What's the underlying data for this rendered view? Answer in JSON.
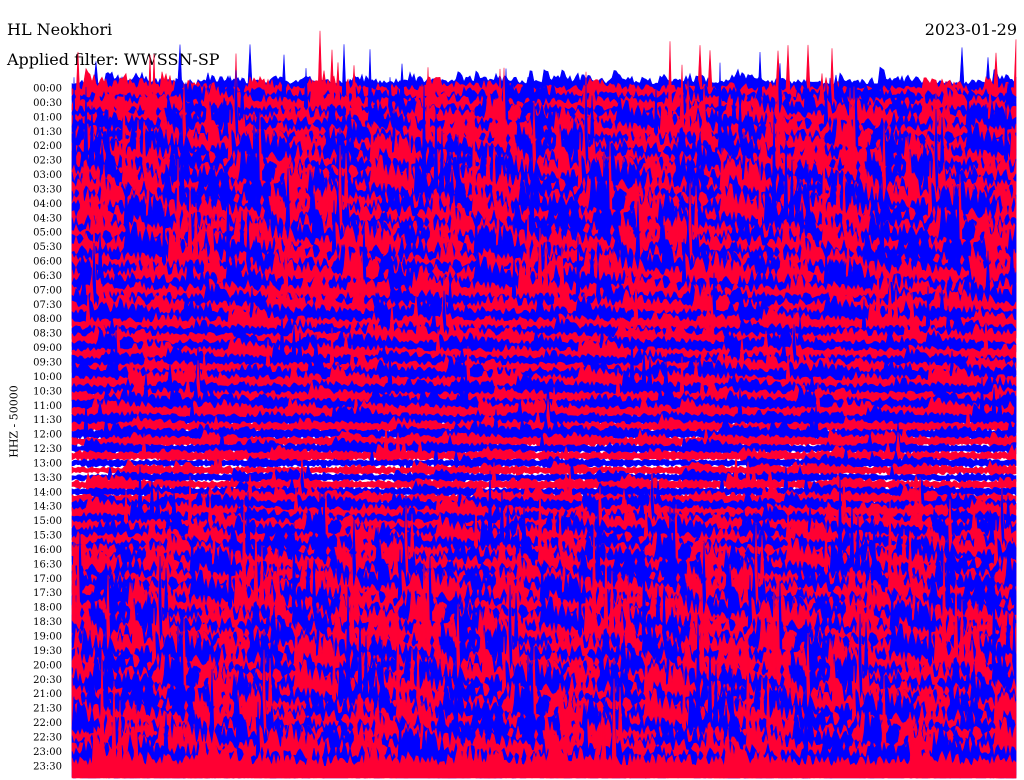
{
  "header": {
    "station": "HL Neokhori",
    "date": "2023-01-29",
    "filter": "Applied filter: WWSSN-SP"
  },
  "channel_label": "HHZ - 50000",
  "chart_data": {
    "type": "line",
    "title": "HL Neokhori",
    "date": "2023-01-29",
    "ylabel": "HHZ - 50000",
    "row_interval_minutes": 15,
    "row_labels": [
      "00:00",
      "00:30",
      "01:00",
      "01:30",
      "02:00",
      "02:30",
      "03:00",
      "03:30",
      "04:00",
      "04:30",
      "05:00",
      "05:30",
      "06:00",
      "06:30",
      "07:00",
      "07:30",
      "08:00",
      "08:30",
      "09:00",
      "09:30",
      "10:00",
      "10:30",
      "11:00",
      "11:30",
      "12:00",
      "12:30",
      "13:00",
      "13:30",
      "14:00",
      "14:30",
      "15:00",
      "15:30",
      "16:00",
      "16:30",
      "17:00",
      "17:30",
      "18:00",
      "18:30",
      "19:00",
      "19:30",
      "20:00",
      "20:30",
      "21:00",
      "21:30",
      "22:00",
      "22:30",
      "23:00",
      "23:30"
    ],
    "trace_colors": [
      "#0000ff",
      "#ff0033"
    ],
    "row_amplitude": [
      0.9,
      1.1,
      1.2,
      1.3,
      1.3,
      1.4,
      1.5,
      1.6,
      1.6,
      1.7,
      1.8,
      1.8,
      1.9,
      1.9,
      2.0,
      2.0,
      2.0,
      2.1,
      2.1,
      2.0,
      2.0,
      2.0,
      1.9,
      1.9,
      1.9,
      1.8,
      1.8,
      1.7,
      1.6,
      1.5,
      1.3,
      1.2,
      1.1,
      1.0,
      0.9,
      0.9,
      0.8,
      0.8,
      0.8,
      0.8,
      0.9,
      0.9,
      0.9,
      0.8,
      0.8,
      0.7,
      0.7,
      0.6,
      0.6,
      0.5,
      0.5,
      0.5,
      0.4,
      0.4,
      0.4,
      0.5,
      0.5,
      0.6,
      0.7,
      0.8,
      0.9,
      1.0,
      1.1,
      1.2,
      1.3,
      1.4,
      1.5,
      1.6,
      1.7,
      1.7,
      1.8,
      1.8,
      1.8,
      1.9,
      1.9,
      1.9,
      1.9,
      2.0,
      2.0,
      2.0,
      2.0,
      2.0,
      2.0,
      2.0,
      2.0,
      2.0,
      2.0,
      2.0,
      2.0,
      2.0,
      2.0,
      2.0,
      2.0,
      2.0,
      2.0,
      2.0
    ],
    "grid": false,
    "legend": "none"
  }
}
